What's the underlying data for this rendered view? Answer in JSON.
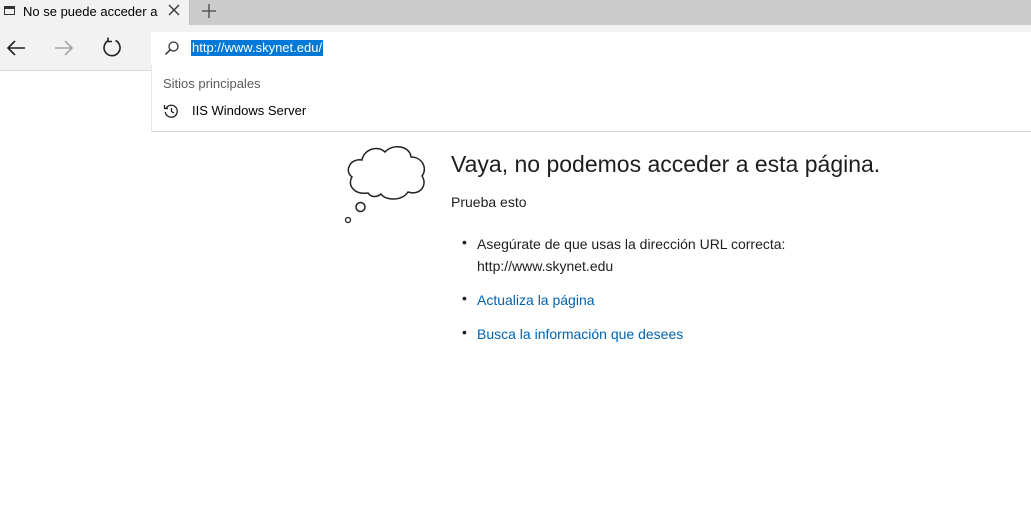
{
  "tab": {
    "title": "No se puede acceder a l",
    "page_icon": "page-icon",
    "close_icon": "close-icon"
  },
  "toolbar": {
    "new_tab_icon": "plus-icon",
    "back_icon": "arrow-left-icon",
    "forward_icon": "arrow-right-icon",
    "refresh_icon": "refresh-icon"
  },
  "address_bar": {
    "search_icon": "search-icon",
    "url": "http://www.skynet.edu/"
  },
  "suggestions": {
    "header": "Sitios principales",
    "items": [
      {
        "icon": "history-icon",
        "label": "IIS Windows Server"
      }
    ]
  },
  "error_page": {
    "illustration": "thought-cloud-icon",
    "title": "Vaya, no podemos acceder a esta página.",
    "subtitle": "Prueba esto",
    "items": [
      {
        "line1": "Asegúrate de que usas la dirección URL correcta:",
        "line2": "http://www.skynet.edu"
      },
      {
        "text": "Actualiza la página"
      },
      {
        "text": "Busca la información que desees"
      }
    ],
    "link_color": "#0063b1"
  },
  "colors": {
    "selection": "#0078d7",
    "tabstrip": "#cccccc",
    "toolbar": "#f2f2f2"
  }
}
